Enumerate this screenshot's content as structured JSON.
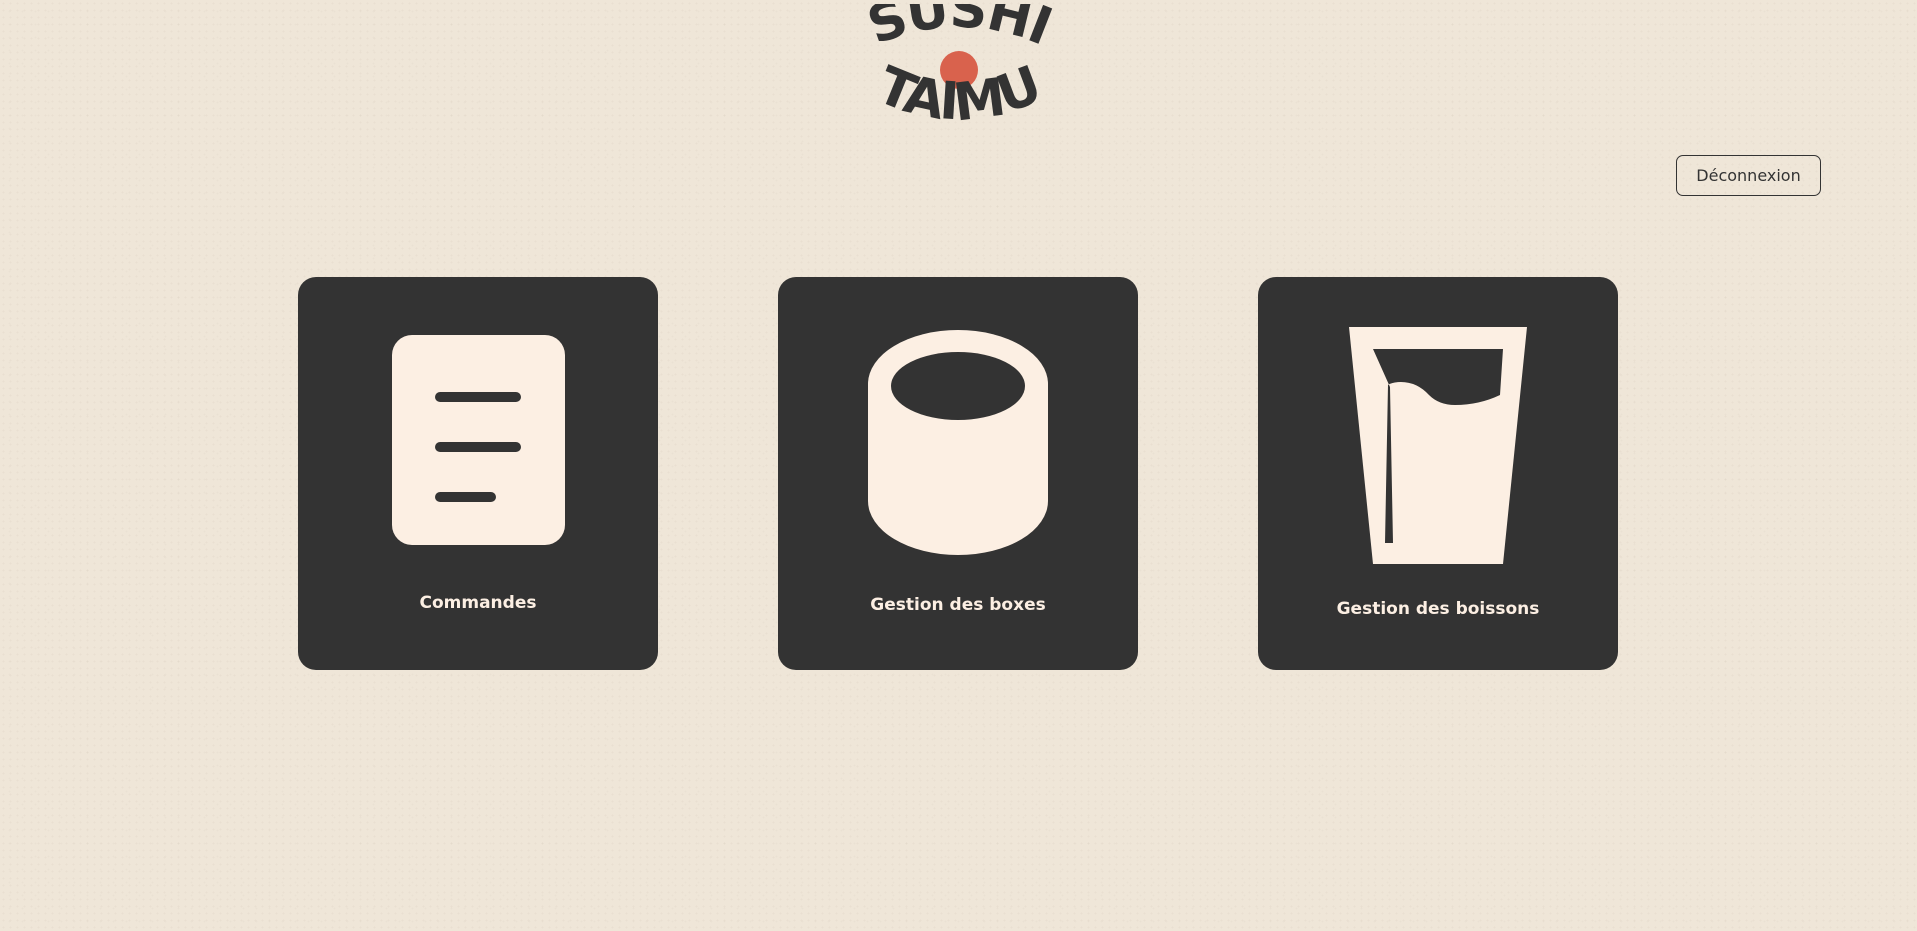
{
  "brand": {
    "name_line1": "SUSHI",
    "name_line2": "TAIMU",
    "logo_icon": "sushi-taimu-logo"
  },
  "header": {
    "logout_label": "Déconnexion"
  },
  "menu": {
    "cards": [
      {
        "label": "Commandes",
        "icon": "document-icon"
      },
      {
        "label": "Gestion des boxes",
        "icon": "sushi-roll-icon"
      },
      {
        "label": "Gestion des boissons",
        "icon": "glass-icon"
      }
    ]
  },
  "colors": {
    "background": "#efe6d8",
    "card": "#333333",
    "icon_fill": "#fcefe3",
    "accent_red": "#d9624d",
    "text": "#333333"
  }
}
